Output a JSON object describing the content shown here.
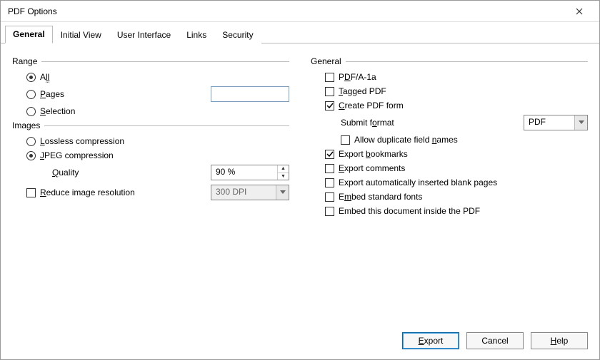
{
  "window": {
    "title": "PDF Options"
  },
  "tabs": [
    {
      "label": "General"
    },
    {
      "label": "Initial View"
    },
    {
      "label": "User Interface"
    },
    {
      "label": "Links"
    },
    {
      "label": "Security"
    }
  ],
  "range": {
    "header": "Range",
    "all_pre": "A",
    "all_u": "ll",
    "pages_u": "P",
    "pages_post": "ages",
    "pages_value": "",
    "selection_u": "S",
    "selection_post": "election"
  },
  "images": {
    "header": "Images",
    "lossless_u": "L",
    "lossless_post": "ossless compression",
    "jpeg_u": "J",
    "jpeg_post": "PEG compression",
    "quality_u": "Q",
    "quality_post": "uality",
    "quality_value": "90 %",
    "reduce_u": "R",
    "reduce_post": "educe image resolution",
    "dpi_value": "300 DPI"
  },
  "general": {
    "header": "General",
    "pdfa_pre": "P",
    "pdfa_u": "D",
    "pdfa_post": "F/A-1a",
    "tagged_u": "T",
    "tagged_post": "agged PDF",
    "form_u": "C",
    "form_post": "reate PDF form",
    "submit_pre": "Submit f",
    "submit_u": "o",
    "submit_post": "rmat",
    "submit_value": "PDF",
    "dup_pre": "Allow duplicate field ",
    "dup_u": "n",
    "dup_post": "ames",
    "bookmarks_pre": "Export ",
    "bookmarks_u": "b",
    "bookmarks_post": "ookmarks",
    "comments_u": "E",
    "comments_post": "xport comments",
    "blank": "Export automatically inserted blank pages",
    "embed_pre": "E",
    "embed_u": "m",
    "embed_post": "bed standard fonts",
    "embeddoc": "Embed this document inside the PDF"
  },
  "buttons": {
    "export_u": "E",
    "export_post": "xport",
    "cancel": "Cancel",
    "help_u": "H",
    "help_post": "elp"
  }
}
